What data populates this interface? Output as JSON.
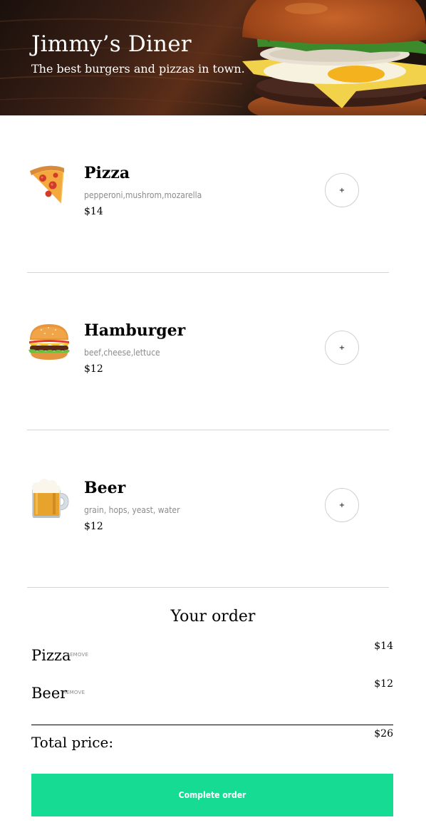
{
  "header": {
    "title": "Jimmy’s Diner",
    "subtitle": "The best burgers and pizzas in town."
  },
  "menu": [
    {
      "name": "Pizza",
      "ingredients": "pepperoni,mushrom,mozarella",
      "price": "$14",
      "emoji": "pizza-emoji",
      "add_label": "+"
    },
    {
      "name": "Hamburger",
      "ingredients": "beef,cheese,lettuce",
      "price": "$12",
      "emoji": "hamburger-emoji",
      "add_label": "+"
    },
    {
      "name": "Beer",
      "ingredients": "grain, hops, yeast, water",
      "price": "$12",
      "emoji": "beer-emoji",
      "add_label": "+"
    }
  ],
  "order": {
    "title": "Your order",
    "items": [
      {
        "name": "Pizza",
        "remove_label": "remove",
        "price": "$14"
      },
      {
        "name": "Beer",
        "remove_label": "remove",
        "price": "$12"
      }
    ],
    "total_label": "Total price:",
    "total_price": "$26",
    "complete_label": "Complete order"
  },
  "colors": {
    "accent": "#16db93",
    "divider": "#d5d5d5",
    "muted_text": "#8b8b8b"
  }
}
